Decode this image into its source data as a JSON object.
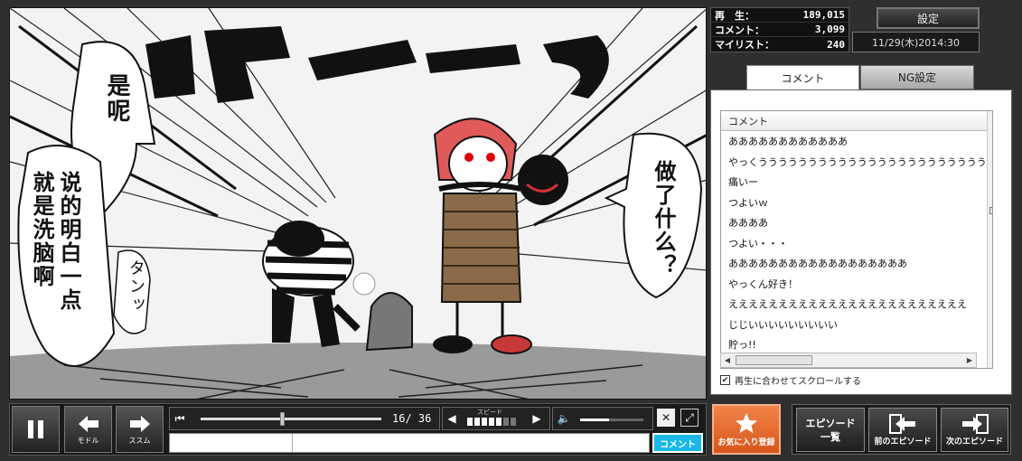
{
  "stats": {
    "views_label": "再　生：",
    "views": "189,015",
    "comments_label": "コメント：",
    "comments": "3,099",
    "mylist_label": "マイリスト：",
    "mylist": "240"
  },
  "settings_label": "設定",
  "date": "11/29(木)2014:30",
  "tabs": {
    "comment": "コメント",
    "ng": "NG設定"
  },
  "comment_list": {
    "header": "コメント",
    "rows": [
      "ああああああああああああ",
      "やっくうううううううううううううううううううううううううううう",
      "痛いー",
      "つよいｗ",
      "ああああ",
      "つよい・・・",
      "ああああああああああああああああああ",
      "やっくん好き！",
      "ええええええええええええええええええええええええ",
      "じじいいいいいいいいい",
      "貯っ!!"
    ]
  },
  "sync_label": "再生に合わせてスクロールする",
  "comic": {
    "sfx_big": "ドキーン",
    "bubble_left": "是呢",
    "text_left_col1": "说的明白一点",
    "text_left_col2": "就是洗脑啊",
    "sfx_small": "タンッ",
    "bubble_right": "做了什么？"
  },
  "player": {
    "back_label": "モドル",
    "forward_label": "ススム",
    "page_current": "16",
    "page_total": "36",
    "page_progress": 0.44,
    "speed_label": "スピード",
    "volume_level": 0.45,
    "comment_button": "コメント"
  },
  "buttons": {
    "favorite": "お気に入り登録",
    "episode_list": "エピソード一覧",
    "prev_episode": "前のエピソード",
    "next_episode": "次のエピソード"
  },
  "colors": {
    "comment_button": "#19b8e8",
    "favorite_button": "#e66a2e",
    "character_hair": "#e05a5a"
  }
}
